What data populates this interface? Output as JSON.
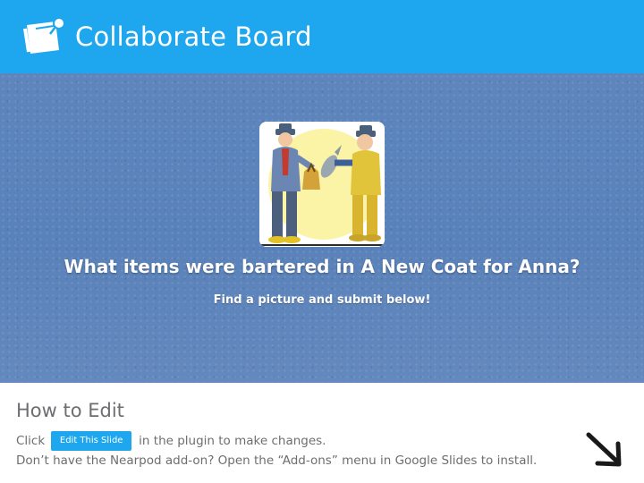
{
  "header": {
    "title": "Collaborate Board",
    "logo_icon": "sticky-note-pin-icon",
    "background": "#1ea7ee"
  },
  "board": {
    "background": "#5f86bc",
    "image": "bartering-fishermen-illustration",
    "question": "What items were bartered in A New Coat for Anna?",
    "instruction": "Find a picture and submit below!"
  },
  "howto": {
    "title": "How to Edit",
    "line1_before": "Click",
    "edit_button_label": "Edit This Slide",
    "line1_after": "in the plugin to make changes.",
    "line2": "Don’t have the Nearpod add-on? Open the “Add-ons” menu in Google Slides to install.",
    "corner_icon": "arrow-down-right-icon"
  }
}
